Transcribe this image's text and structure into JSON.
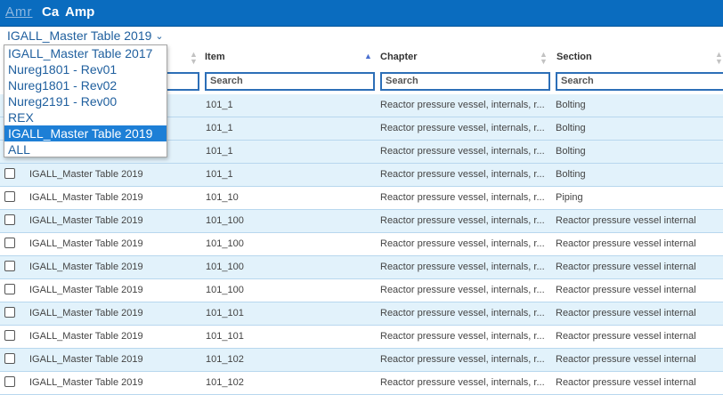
{
  "nav": {
    "amr": "Amr",
    "ca": "Ca",
    "amp": "Amp"
  },
  "selector": {
    "value": "IGALL_Master Table 2019",
    "chevron": "chevron-down-icon"
  },
  "columns": {
    "item": "Item",
    "chapter": "Chapter",
    "section": "Section"
  },
  "filters": {
    "placeholder": "Search",
    "item": "Search",
    "chapter": "Search",
    "section": "Search"
  },
  "dropdown": {
    "options": [
      "IGALL_Master Table 2017",
      "Nureg1801 - Rev01",
      "Nureg1801 - Rev02",
      "Nureg2191 - Rev00",
      "REX",
      "IGALL_Master Table 2019",
      "ALL"
    ],
    "selected": "IGALL_Master Table 2019"
  },
  "rows": [
    {
      "table": "",
      "item": "101_1",
      "chapter": "Reactor pressure vessel, internals, r...",
      "section": "Bolting"
    },
    {
      "table": "",
      "item": "101_1",
      "chapter": "Reactor pressure vessel, internals, r...",
      "section": "Bolting"
    },
    {
      "table": "",
      "item": "101_1",
      "chapter": "Reactor pressure vessel, internals, r...",
      "section": "Bolting"
    },
    {
      "table": "IGALL_Master Table 2019",
      "item": "101_1",
      "chapter": "Reactor pressure vessel, internals, r...",
      "section": "Bolting"
    },
    {
      "table": "IGALL_Master Table 2019",
      "item": "101_10",
      "chapter": "Reactor pressure vessel, internals, r...",
      "section": "Piping"
    },
    {
      "table": "IGALL_Master Table 2019",
      "item": "101_100",
      "chapter": "Reactor pressure vessel, internals, r...",
      "section": "Reactor pressure vessel internal"
    },
    {
      "table": "IGALL_Master Table 2019",
      "item": "101_100",
      "chapter": "Reactor pressure vessel, internals, r...",
      "section": "Reactor pressure vessel internal"
    },
    {
      "table": "IGALL_Master Table 2019",
      "item": "101_100",
      "chapter": "Reactor pressure vessel, internals, r...",
      "section": "Reactor pressure vessel internal"
    },
    {
      "table": "IGALL_Master Table 2019",
      "item": "101_100",
      "chapter": "Reactor pressure vessel, internals, r...",
      "section": "Reactor pressure vessel internal"
    },
    {
      "table": "IGALL_Master Table 2019",
      "item": "101_101",
      "chapter": "Reactor pressure vessel, internals, r...",
      "section": "Reactor pressure vessel internal"
    },
    {
      "table": "IGALL_Master Table 2019",
      "item": "101_101",
      "chapter": "Reactor pressure vessel, internals, r...",
      "section": "Reactor pressure vessel internal"
    },
    {
      "table": "IGALL_Master Table 2019",
      "item": "101_102",
      "chapter": "Reactor pressure vessel, internals, r...",
      "section": "Reactor pressure vessel internal"
    },
    {
      "table": "IGALL_Master Table 2019",
      "item": "101_102",
      "chapter": "Reactor pressure vessel, internals, r...",
      "section": "Reactor pressure vessel internal"
    }
  ]
}
